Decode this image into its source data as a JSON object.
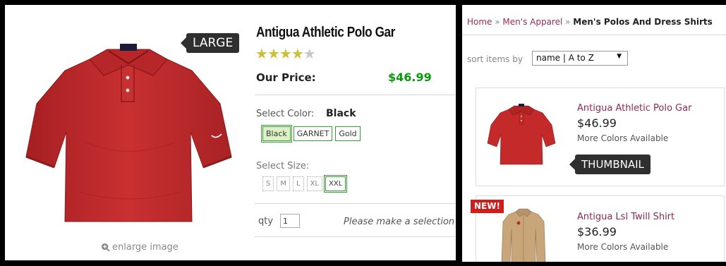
{
  "product": {
    "title": "Antigua Athletic Polo Gar",
    "rating_stars": 4,
    "rating_max": 5,
    "price_label": "Our Price:",
    "price": "$46.99",
    "color_label": "Select Color:",
    "color_selected": "Black",
    "colors": [
      "Black",
      "GARNET",
      "Gold"
    ],
    "size_label": "Select Size:",
    "sizes": [
      "S",
      "M",
      "L",
      "XL",
      "XXL"
    ],
    "qty_label": "qty",
    "qty_value": "1",
    "selection_message": "Please make a selection",
    "enlarge_label": "enlarge image",
    "large_tag": "LARGE"
  },
  "listing": {
    "breadcrumb": {
      "home": "Home",
      "sep1": " » ",
      "category": "Men's Apparel",
      "sep2": " » ",
      "current": "Men's Polos And Dress Shirts"
    },
    "sort_label": "sort items by",
    "sort_value": "name | A to Z",
    "sort_arrow": "▼",
    "items": [
      {
        "name": "Antigua Athletic Polo Gar",
        "price": "$46.99",
        "more": "More Colors Available",
        "image_icon": "polo-shirt-icon"
      },
      {
        "name": "Antigua Lsl Twill Shirt",
        "price": "$36.99",
        "more": "More Colors Available",
        "badge": "NEW!",
        "image_icon": "twill-shirt-icon"
      }
    ],
    "thumbnail_tag": "THUMBNAIL"
  },
  "colors": {
    "shirt_red": "#c42a2a",
    "price_green": "#0a9b0a",
    "link_maroon": "#8d2a51",
    "swatch_green": "#3aa03a",
    "star_gold": "#c9c13a",
    "badge_red": "#d11c1c",
    "callout_bg": "#2f2f2f"
  }
}
